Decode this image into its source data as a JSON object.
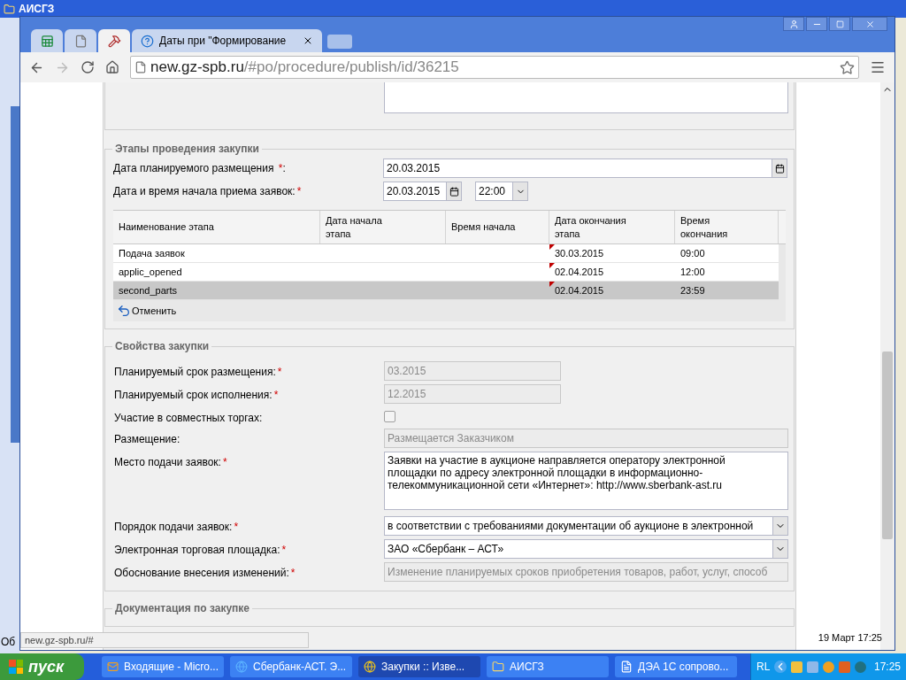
{
  "background_window": {
    "title": "АИСГЗ",
    "fragment": "Об"
  },
  "browser": {
    "tabs": [
      {
        "kind": "sheet",
        "selected": false
      },
      {
        "kind": "page",
        "selected": false
      },
      {
        "kind": "tools",
        "selected": true
      },
      {
        "kind": "help",
        "title": "Даты при \"Формирование",
        "selected": false
      }
    ],
    "address": {
      "host": "new.gz-spb.ru",
      "path": "/#po/procedure/publish/id/36215"
    },
    "status_url": "new.gz-spb.ru/#",
    "status_time": "19 Март 17:25"
  },
  "stages": {
    "title": "Этапы проведения закупки",
    "planned_date": {
      "label": "Дата планируемого размещения ",
      "required_mark": "*",
      "suffix": ":",
      "value": "20.03.2015"
    },
    "start": {
      "label": "Дата и время начала приема заявок:",
      "required_mark": "*",
      "date": "20.03.2015",
      "time": "22:00"
    },
    "columns": [
      "Наименование этапа",
      "Дата начала этапа",
      "Время начала",
      "Дата окончания этапа",
      "Время окончания"
    ],
    "rows": [
      {
        "name": "Подача заявок",
        "end_date": "30.03.2015",
        "end_time": "09:00",
        "edited": true,
        "selected": false
      },
      {
        "name": "applic_opened",
        "end_date": "02.04.2015",
        "end_time": "12:00",
        "edited": true,
        "selected": false
      },
      {
        "name": "second_parts",
        "end_date": "02.04.2015",
        "end_time": "23:59",
        "edited": true,
        "selected": true
      }
    ],
    "cancel": "Отменить"
  },
  "properties": {
    "title": "Свойства закупки",
    "fields": [
      {
        "kind": "short_text",
        "label": "Планируемый срок размещения:",
        "required_mark": "*",
        "value": "03.2015",
        "disabled": true
      },
      {
        "kind": "short_text",
        "label": "Планируемый срок исполнения:",
        "required_mark": "*",
        "value": "12.2015",
        "disabled": true
      },
      {
        "kind": "checkbox",
        "label": "Участие в совместных торгах:",
        "checked": false
      },
      {
        "kind": "text",
        "label": "Размещение:",
        "value": "Размещается Заказчиком",
        "disabled": true
      },
      {
        "kind": "textarea",
        "label": "Место подачи заявок:",
        "required_mark": "*",
        "value": "Заявки на участие в аукционе направляется оператору электронной площадки по адресу электронной площадки в информационно-телекоммуникационной сети «Интернет»: http://www.sberbank-ast.ru"
      },
      {
        "kind": "select",
        "label": "Порядок подачи заявок:",
        "required_mark": "*",
        "value": "в соответствии с требованиями документации об аукционе в электронной"
      },
      {
        "kind": "select",
        "label": "Электронная торговая площадка:",
        "required_mark": "*",
        "value": "ЗАО «Сбербанк – АСТ»"
      },
      {
        "kind": "text",
        "label": "Обоснование внесения изменений:",
        "required_mark": "*",
        "value": "Изменение планируемых сроков приобретения товаров, работ, услуг, способ",
        "disabled": true
      }
    ]
  },
  "documentation": {
    "title": "Документация по закупке"
  },
  "taskbar": {
    "start": "пуск",
    "items": [
      {
        "kind": "mail",
        "label": "Входящие - Micro...",
        "selected": false
      },
      {
        "kind": "ie",
        "label": "Сбербанк-АСТ. Э...",
        "selected": false
      },
      {
        "kind": "chrome",
        "label": "Закупки :: Изве...",
        "selected": true
      },
      {
        "kind": "folder",
        "label": "АИСГЗ",
        "selected": false
      },
      {
        "kind": "doc",
        "label": "ДЭА 1С сопрово...",
        "selected": false
      }
    ],
    "language": "RL",
    "time": "17:25"
  }
}
